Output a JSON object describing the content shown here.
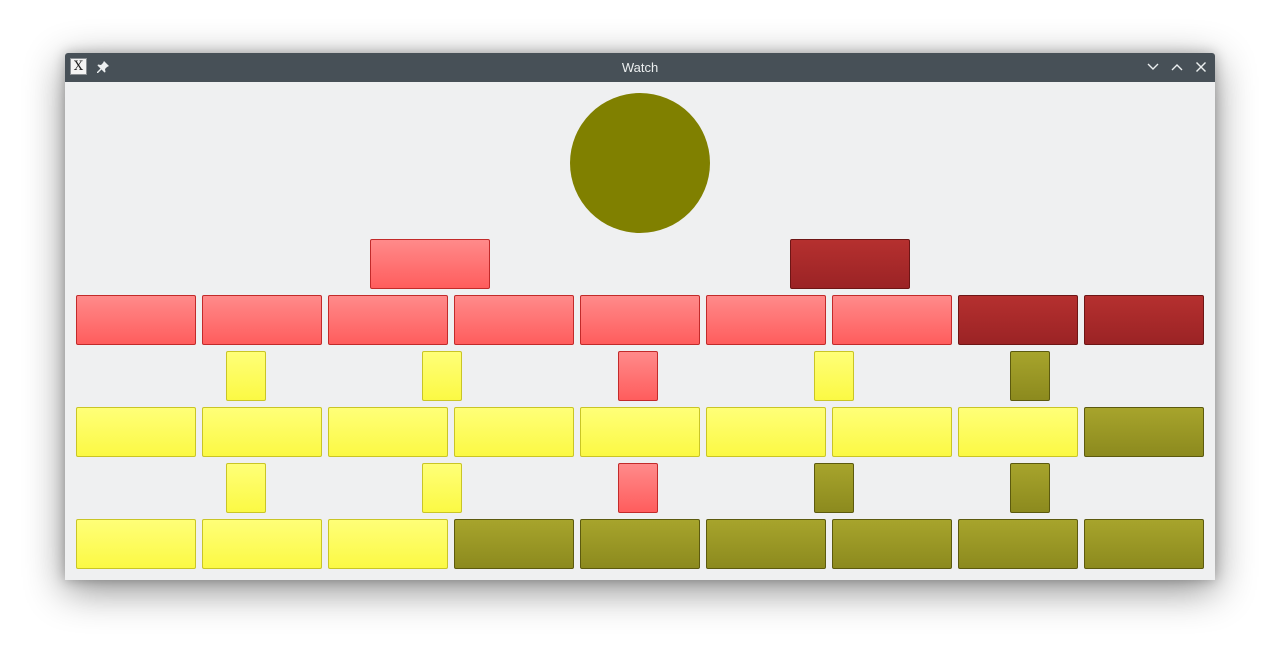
{
  "window": {
    "title": "Watch",
    "app_icon_glyph": "X",
    "icons": {
      "app": "x-app-icon",
      "pin": "pin-icon",
      "minimize": "chevron-down-icon",
      "maximize": "chevron-up-icon",
      "close": "close-icon"
    }
  },
  "clock": {
    "dot_color": "#808000"
  },
  "colors": {
    "red": "#ff7272",
    "darkred": "#a92a2a",
    "yellow": "#fcfc55",
    "olive": "#9a9725",
    "background": "#eff0f1",
    "titlebar": "#475057"
  },
  "rows": {
    "five_hours": [
      "red",
      "darkred"
    ],
    "one_hours": [
      "red",
      "red",
      "red",
      "red",
      "red",
      "red",
      "red",
      "darkred",
      "darkred"
    ],
    "quarter_marks_upper": [
      "yellow",
      "yellow",
      "red",
      "yellow",
      "olive"
    ],
    "five_minutes_upper": [
      "yellow",
      "yellow",
      "yellow",
      "yellow",
      "yellow",
      "yellow",
      "yellow",
      "yellow",
      "olive"
    ],
    "quarter_marks_lower": [
      "yellow",
      "yellow",
      "red",
      "olive",
      "olive"
    ],
    "five_minutes_lower": [
      "yellow",
      "yellow",
      "yellow",
      "olive",
      "olive",
      "olive",
      "olive",
      "olive",
      "olive"
    ]
  }
}
